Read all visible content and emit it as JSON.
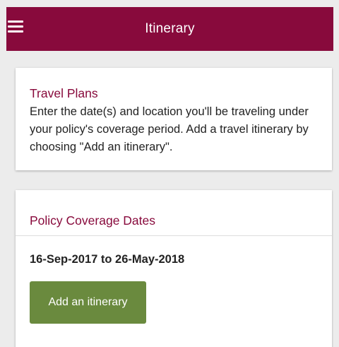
{
  "header": {
    "title": "Itinerary",
    "menu_icon": "hamburger-menu-icon"
  },
  "travel_plans": {
    "title": "Travel Plans",
    "body": "Enter the date(s) and location you'll be traveling under your policy's coverage period. Add a travel itinerary by choosing \"Add an itinerary\"."
  },
  "coverage": {
    "title": "Policy Coverage Dates",
    "dates": "16-Sep-2017 to 26-May-2018",
    "add_button_label": "Add an itinerary"
  },
  "colors": {
    "brand": "#880a3c",
    "button": "#6a8a3e",
    "background": "#ececec"
  }
}
